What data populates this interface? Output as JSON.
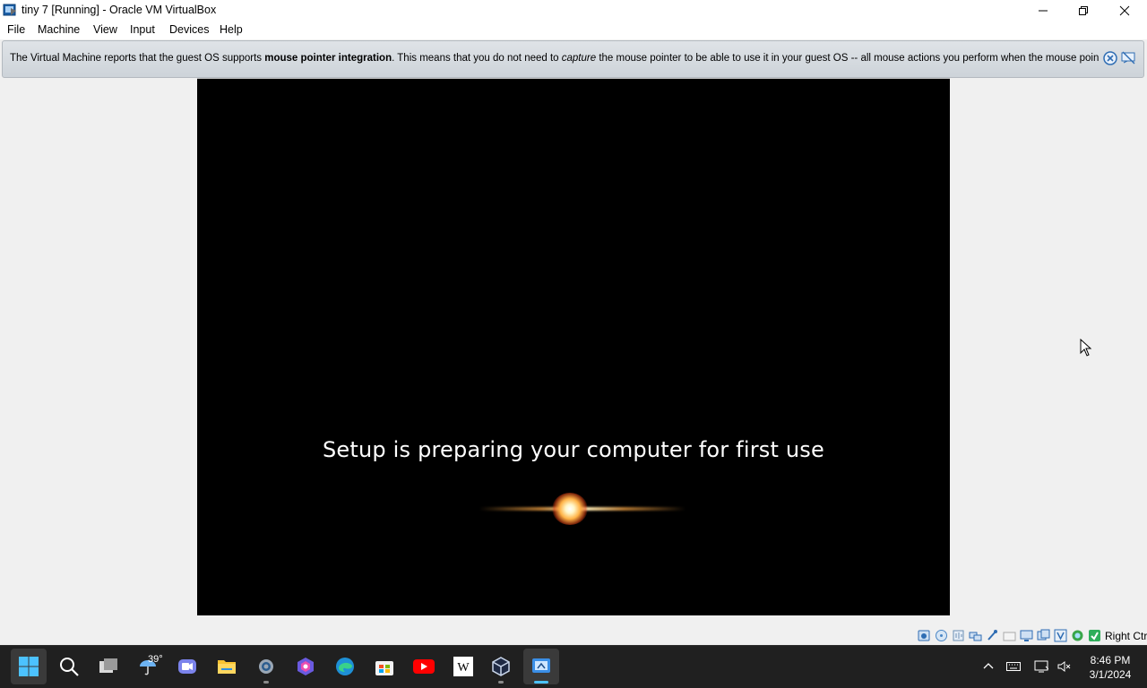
{
  "window": {
    "title": "tiny 7 [Running] - Oracle VM VirtualBox",
    "controls": [
      "minimize-icon",
      "restore-icon",
      "close-icon"
    ]
  },
  "menu": {
    "file": "File",
    "machine": "Machine",
    "view": "View",
    "input": "Input",
    "devices": "Devices",
    "help": "Help"
  },
  "banner": {
    "text_before": "The Virtual Machine reports that the guest OS supports ",
    "bold": "mouse pointer integration",
    "text_middle": ". This means that you do not need to ",
    "italic": "capture",
    "text_after": " the mouse pointer to be able to use it in your guest OS -- all mouse actions you perform when the mouse pointer is over"
  },
  "vm": {
    "setup_text": "Setup is preparing your computer for first use"
  },
  "statusbar": {
    "host_key": "Right Ctrl"
  },
  "taskbar": {
    "weather_temp": "39°",
    "apps": [
      "start-icon",
      "search-icon",
      "task-view-icon",
      "weather-icon",
      "teams-icon",
      "file-explorer-icon",
      "settings-icon",
      "copilot-icon",
      "edge-icon",
      "store-icon",
      "youtube-icon",
      "wikipedia-icon",
      "virtualbox-icon",
      "snipping-tool-icon"
    ]
  },
  "tray": {
    "time": "8:46 PM",
    "date": "3/1/2024"
  },
  "colors": {
    "taskbar_bg": "#202020",
    "vm_bg": "#000000",
    "accent": "#4cc2ff"
  }
}
